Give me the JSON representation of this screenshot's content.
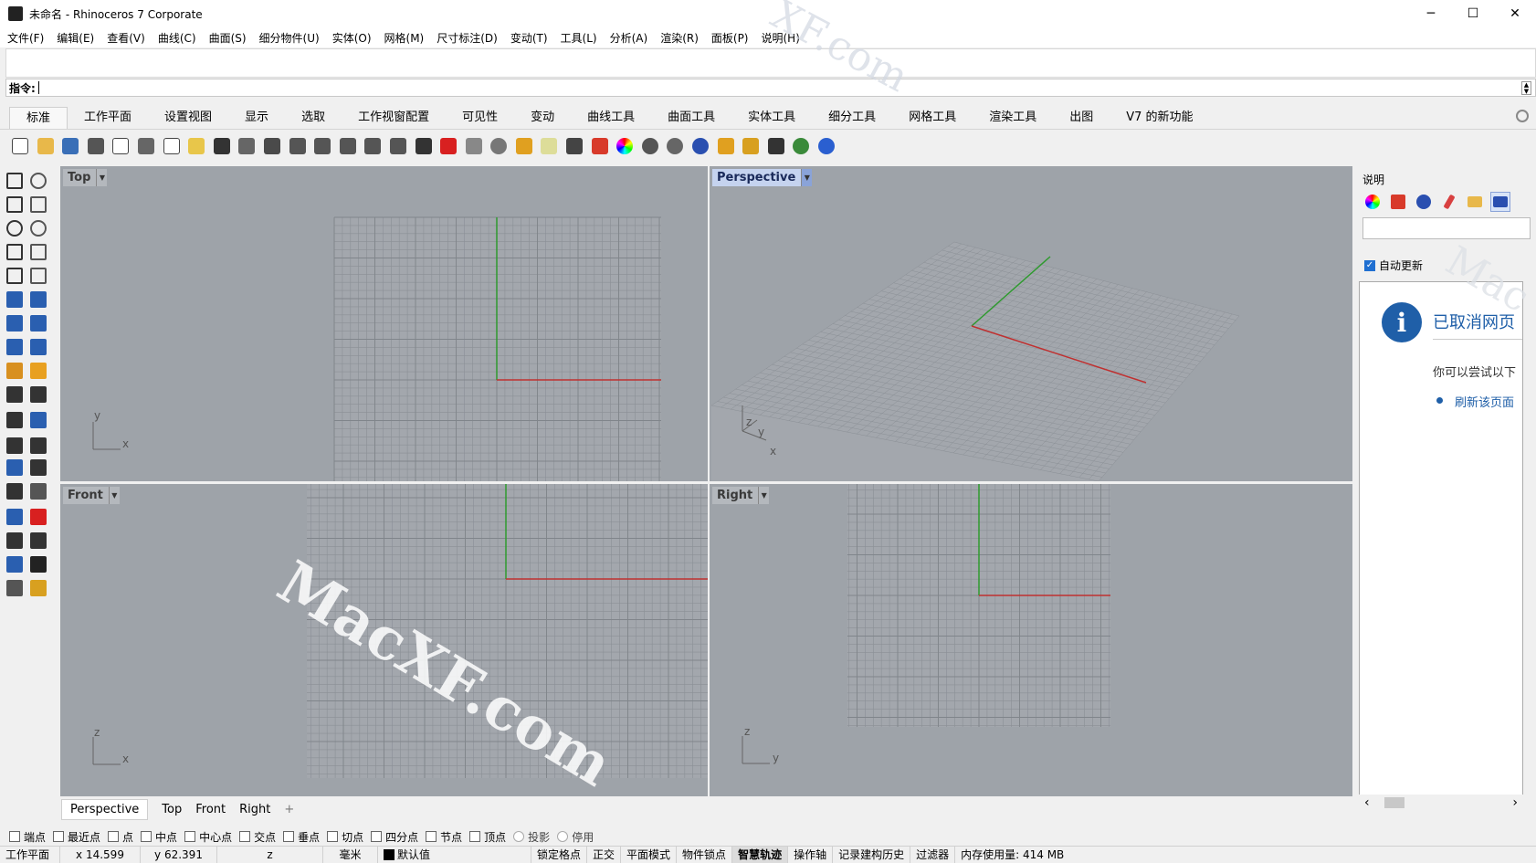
{
  "window": {
    "title": "未命名 - Rhinoceros 7 Corporate",
    "minimize": "─",
    "maximize": "☐",
    "close": "✕"
  },
  "menu": [
    "文件(F)",
    "编辑(E)",
    "查看(V)",
    "曲线(C)",
    "曲面(S)",
    "细分物件(U)",
    "实体(O)",
    "网格(M)",
    "尺寸标注(D)",
    "变动(T)",
    "工具(L)",
    "分析(A)",
    "渲染(R)",
    "面板(P)",
    "说明(H)"
  ],
  "command": {
    "label": "指令:",
    "value": ""
  },
  "tabs": [
    "标准",
    "工作平面",
    "设置视图",
    "显示",
    "选取",
    "工作视窗配置",
    "可见性",
    "变动",
    "曲线工具",
    "曲面工具",
    "实体工具",
    "细分工具",
    "网格工具",
    "渲染工具",
    "出图",
    "V7 的新功能"
  ],
  "active_tab": "标准",
  "toolbar_icons": [
    "new-file",
    "open-file",
    "save",
    "print",
    "import",
    "cut",
    "copy",
    "paste",
    "undo",
    "pan",
    "rotate-view",
    "zoom-dynamic",
    "zoom-window",
    "zoom-extents",
    "zoom-selected",
    "rotate-camera",
    "four-viewports",
    "car-render",
    "ghosted",
    "circle-target",
    "snap",
    "light-bulb",
    "lock",
    "layer",
    "color-wheel",
    "shaded-sphere",
    "rendered-sphere",
    "blue-sphere",
    "select-filter",
    "gear-settings",
    "grid-snap",
    "globe",
    "help"
  ],
  "toolbar_colors": [
    "#ffffff",
    "#e8b84a",
    "#3a6fb7",
    "#555555",
    "#ffffff",
    "#666666",
    "#ffffff",
    "#e8c64a",
    "#333333",
    "#666666",
    "#4a4a4a",
    "#555555",
    "#555555",
    "#555555",
    "#555555",
    "#555555",
    "#333333",
    "#d82020",
    "#888888",
    "#777777",
    "#e0a020",
    "#dddd99",
    "#444444",
    "#d83a2a",
    "#e04080",
    "#555555",
    "#666666",
    "#2a4fb0",
    "#e0a020",
    "#d8a020",
    "#333333",
    "#3a8a3a",
    "#2a5fd0"
  ],
  "toolbox_colors": [
    "#333",
    "#555",
    "#333",
    "#555",
    "#333",
    "#555",
    "#333",
    "#555",
    "#333",
    "#555",
    "#2a5fb0",
    "#2a5fb0",
    "#2a5fb0",
    "#2a5fb0",
    "#2a5fb0",
    "#2a5fb0",
    "#d89020",
    "#e8a020",
    "#333",
    "#333",
    "#333",
    "#2a5fb0",
    "#333",
    "#333",
    "#2a5fb0",
    "#333",
    "#333",
    "#555",
    "#2a5fb0",
    "#d82020",
    "#333",
    "#333",
    "#2a5fb0",
    "#222",
    "#555",
    "#d8a020"
  ],
  "viewports": {
    "top": {
      "label": "Top",
      "axis1": "y",
      "axis2": "x"
    },
    "perspective": {
      "label": "Perspective",
      "axis1": "z",
      "axis2": "y",
      "axis3": "x"
    },
    "front": {
      "label": "Front",
      "axis1": "z",
      "axis2": "x"
    },
    "right": {
      "label": "Right",
      "axis1": "z",
      "axis2": "y"
    }
  },
  "view_tabs": [
    "Perspective",
    "Top",
    "Front",
    "Right"
  ],
  "view_tab_add": "+",
  "watermark": "MacXF.com",
  "watermark_top": "XF.com",
  "watermark_right": "Mac",
  "right_panel": {
    "header": "说明",
    "icons": [
      "color-wheel",
      "layer",
      "material",
      "brush",
      "folder",
      "help-doc"
    ],
    "auto_update_label": "自动更新",
    "auto_update_checked": true,
    "info_icon": "i",
    "browser_title": "已取消网页",
    "browser_desc": "你可以尝试以下",
    "browser_link": "刷新该页面",
    "scroll_left": "‹",
    "scroll_right": "›"
  },
  "osnaps": [
    {
      "label": "端点",
      "checked": false
    },
    {
      "label": "最近点",
      "checked": false
    },
    {
      "label": "点",
      "checked": false
    },
    {
      "label": "中点",
      "checked": false
    },
    {
      "label": "中心点",
      "checked": false
    },
    {
      "label": "交点",
      "checked": false
    },
    {
      "label": "垂点",
      "checked": false
    },
    {
      "label": "切点",
      "checked": false
    },
    {
      "label": "四分点",
      "checked": false
    },
    {
      "label": "节点",
      "checked": false
    },
    {
      "label": "顶点",
      "checked": false
    },
    {
      "label": "投影",
      "checked": false
    },
    {
      "label": "停用",
      "checked": false
    }
  ],
  "status": {
    "cplane": "工作平面",
    "x": "x 14.599",
    "y": "y 62.391",
    "z": "z",
    "units": "毫米",
    "layer": "默认值",
    "grid_snap": "锁定格点",
    "ortho": "正交",
    "planar": "平面模式",
    "osnap": "物件锁点",
    "smarttrack": "智慧轨迹",
    "gumball": "操作轴",
    "history": "记录建构历史",
    "filter": "过滤器",
    "memory": "内存使用量: 414 MB"
  }
}
